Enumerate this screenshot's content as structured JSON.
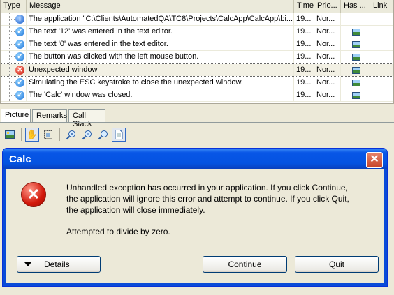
{
  "grid": {
    "columns": [
      "Type",
      "Message",
      "Time",
      "Prio...",
      "Has ...",
      "Link"
    ],
    "rows": [
      {
        "icon": "info-icon",
        "message": "The application \"C:\\Clients\\AutomatedQA\\TC8\\Projects\\CalcApp\\CalcApp\\bi...",
        "time": "19...",
        "priority": "Nor...",
        "has_picture": false
      },
      {
        "icon": "check-icon",
        "message": "The text '12' was entered in the text editor.",
        "time": "19...",
        "priority": "Nor...",
        "has_picture": true
      },
      {
        "icon": "check-icon",
        "message": "The text '0' was entered in the text editor.",
        "time": "19...",
        "priority": "Nor...",
        "has_picture": true
      },
      {
        "icon": "check-icon",
        "message": "The button was clicked with the left mouse button.",
        "time": "19...",
        "priority": "Nor...",
        "has_picture": true
      },
      {
        "icon": "error-icon",
        "message": "Unexpected window",
        "time": "19...",
        "priority": "Nor...",
        "has_picture": true,
        "selected": true
      },
      {
        "icon": "check-icon",
        "message": "Simulating the ESC keystroke to close the unexpected window.",
        "time": "19...",
        "priority": "Nor...",
        "has_picture": true
      },
      {
        "icon": "check-icon",
        "message": "The 'Calc' window was closed.",
        "time": "19...",
        "priority": "Nor...",
        "has_picture": true
      }
    ]
  },
  "tabs": [
    "Picture",
    "Remarks",
    "Call Stack"
  ],
  "active_tab": "Picture",
  "toolbar": {
    "buttons": [
      "picture-icon",
      "hand-icon",
      "select-icon",
      "zoom-in-icon",
      "zoom-out-icon",
      "zoom-actual-icon",
      "page-icon"
    ]
  },
  "dialog": {
    "title": "Calc",
    "close": "✕",
    "message": "Unhandled exception has occurred in your application. If you click Continue, the application will ignore this error and attempt to continue. If you click Quit, the application will close immediately.",
    "detail": "Attempted to divide by zero.",
    "details_button": "Details",
    "continue_button": "Continue",
    "quit_button": "Quit"
  }
}
